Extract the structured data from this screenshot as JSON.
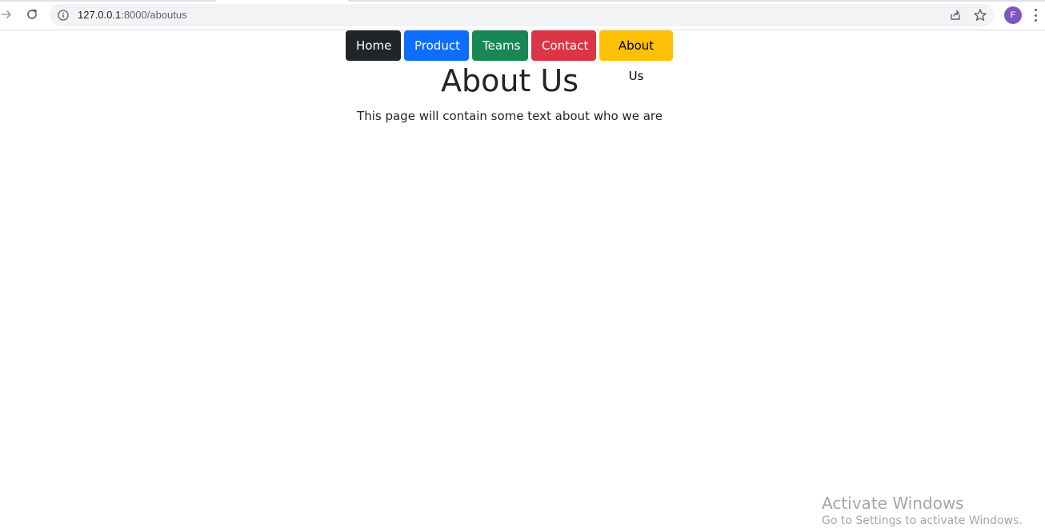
{
  "browser": {
    "url_host": "127.0.0.1",
    "url_path": ":8000/aboutus",
    "profile_initial": "F",
    "icons": [
      "forward-icon",
      "reload-icon",
      "info-icon",
      "share-icon",
      "star-icon",
      "menu-icon"
    ],
    "avatar_color": "#7e57c2"
  },
  "nav": {
    "buttons": [
      {
        "label": "Home",
        "color": "#212529"
      },
      {
        "label": "Product",
        "color": "#0d6efd"
      },
      {
        "label": "Teams",
        "color": "#198754"
      },
      {
        "label": "Contact",
        "color": "#dc3545"
      },
      {
        "label": "About Us",
        "color": "#ffc107"
      }
    ]
  },
  "main": {
    "title": "About Us",
    "text": "This page will contain some text about who we are"
  },
  "watermark": {
    "title": "Activate Windows",
    "subtitle": "Go to Settings to activate Windows."
  }
}
